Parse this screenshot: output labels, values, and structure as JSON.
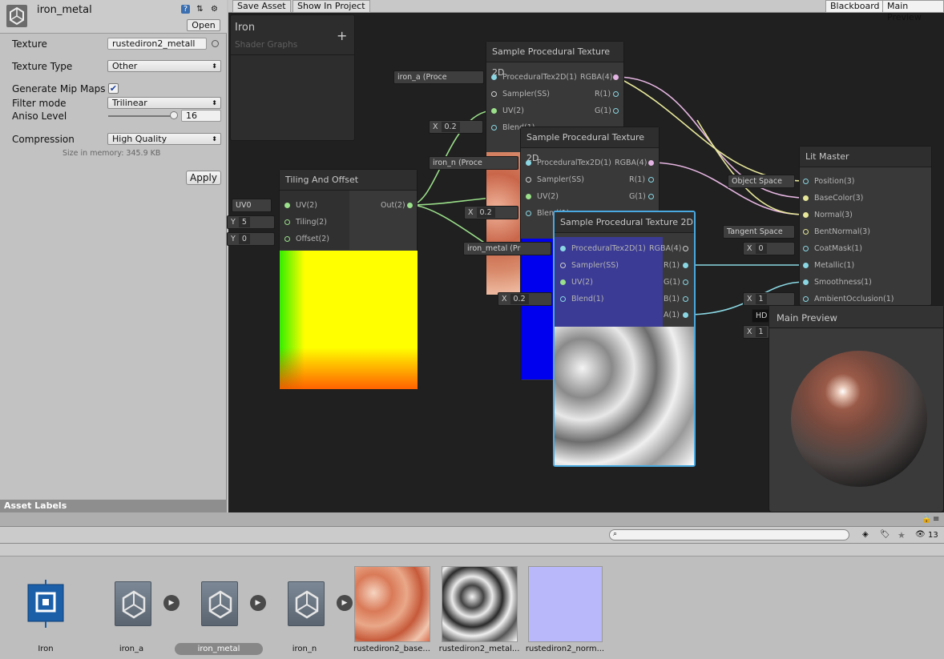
{
  "inspector": {
    "title": "iron_metal",
    "open_label": "Open",
    "texture_label": "Texture",
    "texture_value": "rustediron2_metall",
    "texture_type_label": "Texture Type",
    "texture_type_value": "Other",
    "mip_label": "Generate Mip Maps",
    "mip_checked": true,
    "filter_label": "Filter mode",
    "filter_value": "Trilinear",
    "aniso_label": "Aniso Level",
    "aniso_value": "16",
    "compression_label": "Compression",
    "compression_value": "High Quality",
    "size_text": "Size in memory: 345.9 KB",
    "apply_label": "Apply",
    "asset_labels": "Asset Labels"
  },
  "toolbar": {
    "save_asset": "Save Asset",
    "show_in_project": "Show In Project",
    "blackboard": "Blackboard",
    "main_preview": "Main Preview"
  },
  "blackboard_panel": {
    "title": "Iron",
    "subtitle": "Shader Graphs",
    "add": "+"
  },
  "nodes": {
    "tiling": {
      "title": "Tiling And Offset",
      "in_uv": "UV(2)",
      "in_tiling": "Tiling(2)",
      "in_offset": "Offset(2)",
      "out": "Out(2)",
      "uv_chip": "UV0",
      "tiling_chip_axis": "Y",
      "tiling_chip_val": "5",
      "offset_chip_axis": "Y",
      "offset_chip_val": "0"
    },
    "sample1": {
      "title": "Sample Procedural Texture 2D",
      "in1": "ProceduralTex2D(1)",
      "in2": "Sampler(SS)",
      "in3": "UV(2)",
      "in4": "Blend(1)",
      "out1": "RGBA(4)",
      "out2": "R(1)",
      "out3": "G(1)",
      "out4": "B(1)",
      "chip": "iron_a (Proce",
      "blend_axis": "X",
      "blend_val": "0.2"
    },
    "sample2": {
      "title": "Sample Procedural Texture 2D",
      "in1": "ProceduralTex2D(1)",
      "in2": "Sampler(SS)",
      "in3": "UV(2)",
      "in4": "Blend(1)",
      "out1": "RGBA(4)",
      "out2": "R(1)",
      "out3": "G(1)",
      "out4": "B(1)",
      "chip": "iron_n (Proce",
      "blend_axis": "X",
      "blend_val": "0.2"
    },
    "sample3": {
      "title": "Sample Procedural Texture 2D",
      "in1": "ProceduralTex2D(1)",
      "in2": "Sampler(SS)",
      "in3": "UV(2)",
      "in4": "Blend(1)",
      "out1": "RGBA(4)",
      "out2": "R(1)",
      "out3": "G(1)",
      "out4": "B(1)",
      "out5": "A(1)",
      "chip": "iron_metal (Pr",
      "blend_axis": "X",
      "blend_val": "0.2"
    },
    "master": {
      "title": "Lit Master",
      "in1": "Position(3)",
      "in2": "BaseColor(3)",
      "in3": "Normal(3)",
      "in4": "BentNormal(3)",
      "in5": "CoatMask(1)",
      "in6": "Metallic(1)",
      "in7": "Smoothness(1)",
      "in8": "AmbientOcclusion(1)",
      "object_space": "Object Space",
      "tangent_space": "Tangent Space",
      "coat_axis": "X",
      "coat_val": "0",
      "ao_axis": "X",
      "ao_val": "1",
      "hd_label": "HD",
      "extra_axis": "X",
      "extra_val": "1"
    }
  },
  "preview": {
    "title": "Main Preview"
  },
  "project": {
    "count": "13",
    "assets": [
      {
        "label": "Iron"
      },
      {
        "label": "iron_a"
      },
      {
        "label": "iron_metal"
      },
      {
        "label": "iron_n"
      },
      {
        "label": "rustediron2_base..."
      },
      {
        "label": "rustediron2_metal..."
      },
      {
        "label": "rustediron2_norm..."
      }
    ]
  },
  "colors": {
    "graph_bg": "#202020",
    "wire_green": "#9be08a",
    "wire_yellow": "#e7e79a",
    "wire_pink": "#e6b6e2",
    "wire_cyan": "#8ad7e3",
    "selection": "#4aa9e0"
  }
}
